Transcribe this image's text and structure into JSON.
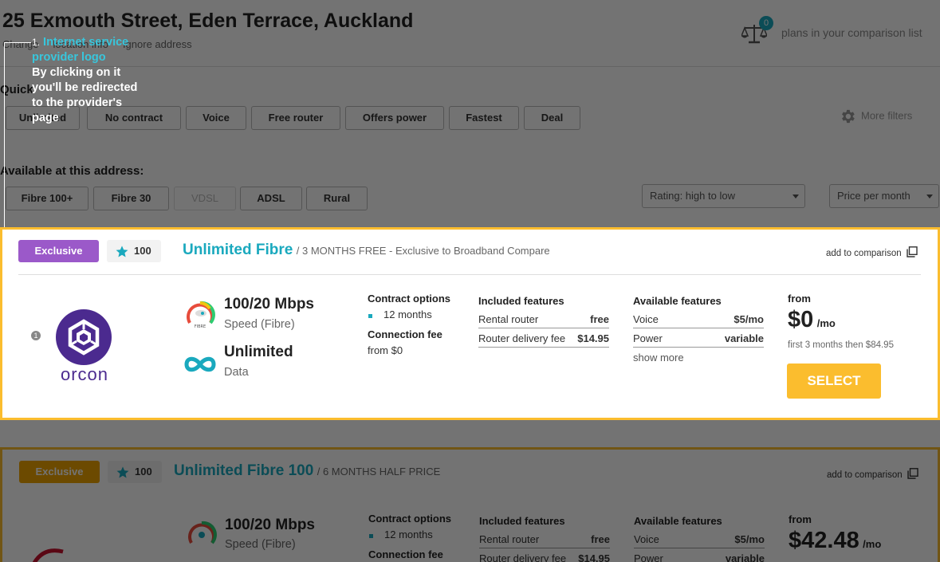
{
  "header": {
    "address": "25 Exmouth Street, Eden Terrace, Auckland",
    "links": [
      "Change",
      "location info",
      "Ignore address"
    ],
    "compare_count": "0",
    "compare_label": "plans in your comparison list"
  },
  "filters": {
    "quick_label": "Quick",
    "quick_pills": [
      "Unlimited",
      "No contract",
      "Voice",
      "Free router",
      "Offers power",
      "Fastest",
      "Deal"
    ],
    "more_filters": "More filters",
    "available_label": "Available at this address:",
    "connection_pills": [
      "Fibre 100+",
      "Fibre 30",
      "VDSL",
      "ADSL",
      "Rural"
    ],
    "sort_select": "Rating: high to low",
    "price_select": "Price per month"
  },
  "tooltip": {
    "number": "1.",
    "title": "Internet service provider logo",
    "body": "By clicking on it you'll be redirected to the provider's page",
    "marker": "1"
  },
  "plans": [
    {
      "badge": "Exclusive",
      "rating": "100",
      "name": "Unlimited Fibre",
      "promo": "/ 3 MONTHS FREE - Exclusive to Broadband Compare",
      "add_compare": "add to comparison",
      "provider": "orcon",
      "speed": "100/20 Mbps",
      "speed_label": "Speed (Fibre)",
      "gauge_text": "FIBRE",
      "data": "Unlimited",
      "data_label": "Data",
      "contract_head": "Contract options",
      "contract": "12 months",
      "connection_head": "Connection fee",
      "connection": "from $0",
      "included_head": "Included features",
      "included": [
        {
          "name": "Rental router",
          "value": "free"
        },
        {
          "name": "Router delivery fee",
          "value": "$14.95"
        }
      ],
      "available_head": "Available features",
      "available": [
        {
          "name": "Voice",
          "value": "$5/mo"
        },
        {
          "name": "Power",
          "value": "variable"
        }
      ],
      "show_more": "show more",
      "from": "from",
      "price": "$0",
      "per": "/mo",
      "price_note": "first 3 months then $84.95",
      "select": "SELECT"
    },
    {
      "badge": "Exclusive",
      "rating": "100",
      "name": "Unlimited Fibre 100",
      "promo": "/ 6 MONTHS HALF PRICE",
      "add_compare": "add to comparison",
      "speed": "100/20 Mbps",
      "speed_label": "Speed (Fibre)",
      "contract_head": "Contract options",
      "contract": "12 months",
      "connection_head": "Connection fee",
      "included_head": "Included features",
      "included": [
        {
          "name": "Rental router",
          "value": "free"
        },
        {
          "name": "Router delivery fee",
          "value": "$14.95"
        }
      ],
      "available_head": "Available features",
      "available": [
        {
          "name": "Voice",
          "value": "$5/mo"
        },
        {
          "name": "Power",
          "value": "variable"
        }
      ],
      "from": "from",
      "price": "$42.48",
      "per": "/mo"
    }
  ],
  "colors": {
    "accent": "#1aa9be",
    "highlight_border": "#fbbd2e",
    "select_button": "#fbbd2e",
    "exclusive_badge": "#9b59c9",
    "orcon_brand": "#4b2a8f"
  }
}
